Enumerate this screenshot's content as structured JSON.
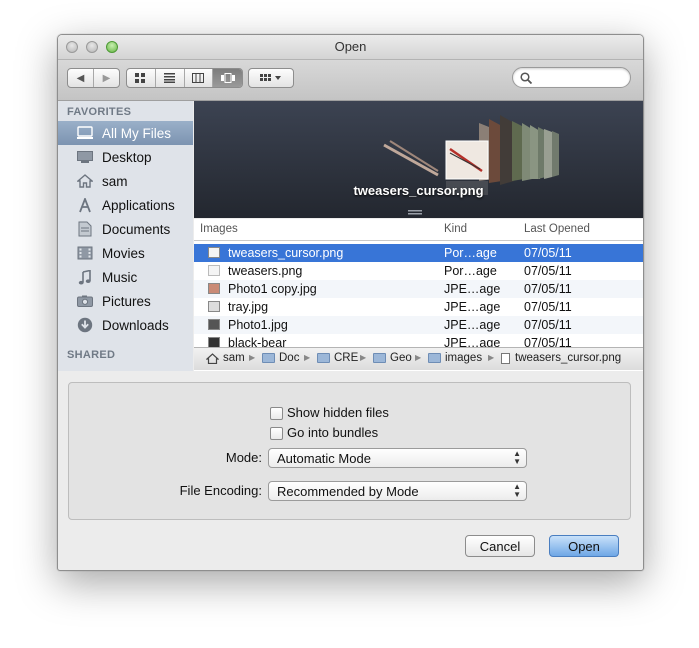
{
  "window": {
    "title": "Open"
  },
  "toolbar": {
    "back_label": "◀",
    "forward_label": "▶",
    "views": [
      "icon-view",
      "list-view",
      "column-view",
      "coverflow-view"
    ],
    "search_placeholder": ""
  },
  "sidebar": {
    "favorites_header": "FAVORITES",
    "items": [
      {
        "label": "All My Files",
        "icon": "all-files-icon",
        "selected": true
      },
      {
        "label": "Desktop",
        "icon": "desktop-icon"
      },
      {
        "label": "sam",
        "icon": "home-icon"
      },
      {
        "label": "Applications",
        "icon": "applications-icon"
      },
      {
        "label": "Documents",
        "icon": "documents-icon"
      },
      {
        "label": "Movies",
        "icon": "movies-icon"
      },
      {
        "label": "Music",
        "icon": "music-icon"
      },
      {
        "label": "Pictures",
        "icon": "pictures-icon"
      },
      {
        "label": "Downloads",
        "icon": "downloads-icon"
      }
    ],
    "shared_header": "SHARED"
  },
  "preview": {
    "filename": "tweasers_cursor.png"
  },
  "list": {
    "columns": {
      "name": "Images",
      "kind": "Kind",
      "date": "Last Opened"
    },
    "rows": [
      {
        "name": "tweasers_cursor.png",
        "kind": "Por…age",
        "date": "07/05/11",
        "selected": true
      },
      {
        "name": "tweasers.png",
        "kind": "Por…age",
        "date": "07/05/11"
      },
      {
        "name": "Photo1 copy.jpg",
        "kind": "JPE…age",
        "date": "07/05/11"
      },
      {
        "name": "tray.jpg",
        "kind": "JPE…age",
        "date": "07/05/11"
      },
      {
        "name": "Photo1.jpg",
        "kind": "JPE…age",
        "date": "07/05/11"
      },
      {
        "name": "black-bear",
        "kind": "JPE…age",
        "date": "07/05/11"
      }
    ]
  },
  "pathbar": {
    "items": [
      "sam",
      "Doc",
      "CRE",
      "Geo",
      "images",
      "tweasers_cursor.png"
    ]
  },
  "options": {
    "show_hidden_label": "Show hidden files",
    "go_into_bundles_label": "Go into bundles",
    "mode_label": "Mode:",
    "mode_value": "Automatic Mode",
    "encoding_label": "File Encoding:",
    "encoding_value": "Recommended by Mode"
  },
  "buttons": {
    "cancel": "Cancel",
    "open": "Open"
  },
  "colors": {
    "selection": "#3875d7",
    "sidebar": "#dfe3e9",
    "default_button": "#6fa7e6"
  }
}
